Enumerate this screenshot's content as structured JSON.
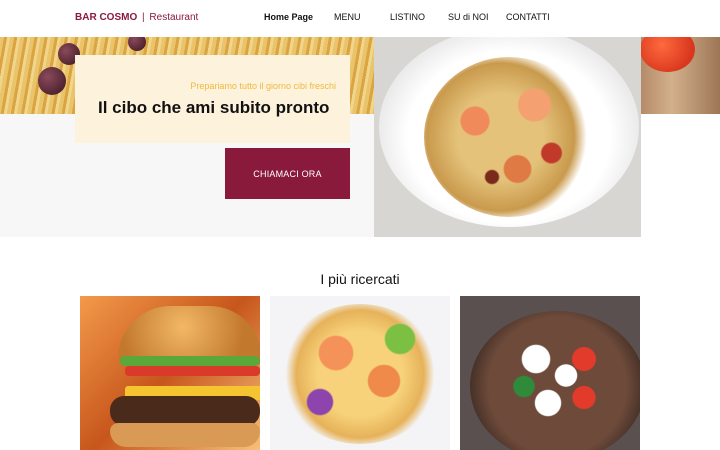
{
  "header": {
    "brand_name": "BAR COSMO",
    "brand_separator": "|",
    "brand_subtitle": "Restaurant",
    "nav": [
      "Home Page",
      "MENU",
      "LISTINO",
      "SU di NOI",
      "CONTATTI"
    ]
  },
  "hero": {
    "tagline": "Prepariamo tutto il giorno cibi freschi",
    "title": "Il cibo che ami subito pronto",
    "cta_label": "CHIAMACI ORA"
  },
  "section": {
    "title": "I più ricercati"
  },
  "colors": {
    "brand": "#8a1a3c",
    "tagline": "#f0b840",
    "hero_box": "#fdf3dc"
  }
}
